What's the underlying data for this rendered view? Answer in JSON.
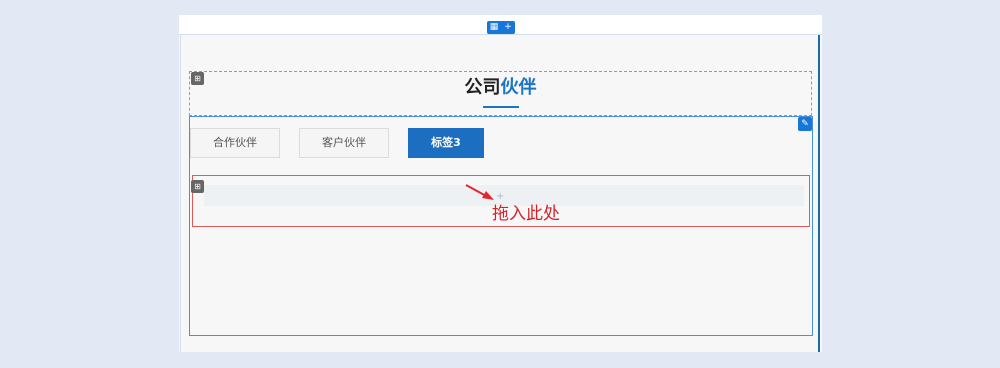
{
  "editor": {
    "top_controls": [
      {
        "icon": "grid-icon",
        "glyph": "▦"
      },
      {
        "icon": "plus-icon",
        "glyph": "+"
      }
    ],
    "handle_glyph": "⊞",
    "edit_glyph": "✎"
  },
  "section": {
    "title_part1": "公司",
    "title_part2": "伙伴",
    "accent_color": "#1c74c4"
  },
  "tabs": [
    {
      "label": "合作伙伴",
      "active": false
    },
    {
      "label": "客户伙伴",
      "active": false
    },
    {
      "label": "标签3",
      "active": true
    }
  ],
  "drop_zone": {
    "plus_hint": "+",
    "label": "拖入此处",
    "label_color": "#d3232a"
  }
}
